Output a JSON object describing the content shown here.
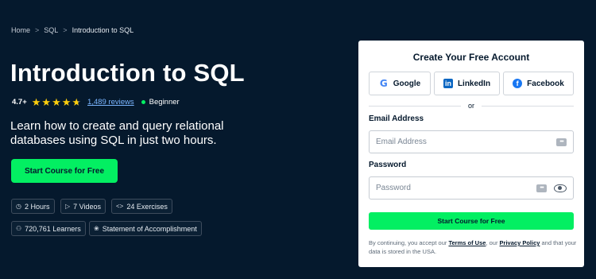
{
  "breadcrumb": {
    "items": [
      "Home",
      "SQL",
      "Introduction to SQL"
    ],
    "separator": ">"
  },
  "course": {
    "title": "Introduction to SQL",
    "rating": "4.7+",
    "stars_filled": 4.7,
    "reviews": "1,489 reviews",
    "level": "Beginner",
    "description": "Learn how to create and query relational databases using SQL in just two hours.",
    "cta_label": "Start Course for Free"
  },
  "stats": {
    "hours": "2 Hours",
    "videos": "7 Videos",
    "exercises": "24 Exercises",
    "learners": "720,761 Learners",
    "accomplishment": "Statement of Accomplishment"
  },
  "signup": {
    "title": "Create Your Free Account",
    "google": "Google",
    "linkedin": "LinkedIn",
    "facebook": "Facebook",
    "or": "or",
    "email_label": "Email Address",
    "email_placeholder": "Email Address",
    "password_label": "Password",
    "password_placeholder": "Password",
    "submit": "Start Course for Free",
    "legal_pre": "By continuing, you accept our ",
    "terms": "Terms of Use",
    "legal_mid": ", our ",
    "privacy": "Privacy Policy",
    "legal_post": " and that your data is stored in the USA."
  },
  "colors": {
    "background": "#05192d",
    "accent": "#03ef62",
    "star": "#fcce0d",
    "link": "#7ab5ff"
  },
  "icons": {
    "hours": "clock-icon",
    "videos": "play-icon",
    "exercises": "code-icon",
    "learners": "users-icon",
    "accomplishment": "ribbon-icon"
  }
}
